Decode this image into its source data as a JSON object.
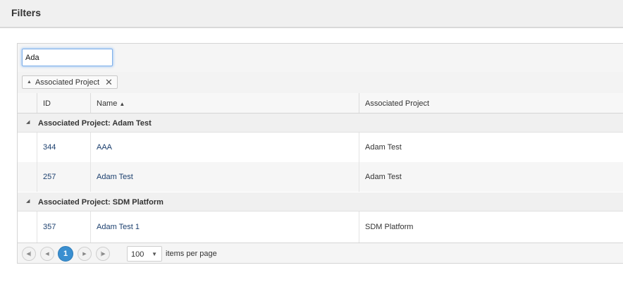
{
  "header": {
    "title": "Filters"
  },
  "search": {
    "value": "Ada"
  },
  "grouping": {
    "chip_label": "Associated Project",
    "chip_sort_icon": "arrow-up-icon",
    "chip_remove_icon": "close-icon"
  },
  "table": {
    "columns": {
      "id": "ID",
      "name": "Name",
      "project": "Associated Project"
    },
    "sort": {
      "column": "Name",
      "direction": "ascending"
    },
    "groups": [
      {
        "label": "Associated Project: Adam Test",
        "rows": [
          {
            "id": "344",
            "name": "AAA",
            "project": "Adam Test"
          },
          {
            "id": "257",
            "name": "Adam Test",
            "project": "Adam Test"
          }
        ]
      },
      {
        "label": "Associated Project: SDM Platform",
        "rows": [
          {
            "id": "357",
            "name": "Adam Test 1",
            "project": "SDM Platform"
          }
        ]
      }
    ]
  },
  "pager": {
    "current_page": "1",
    "page_size": "100",
    "items_per_page_label": "items per page"
  },
  "colors": {
    "accent": "#3a8fd0",
    "link": "#1b3f6e",
    "focus": "#7fb0ea"
  }
}
